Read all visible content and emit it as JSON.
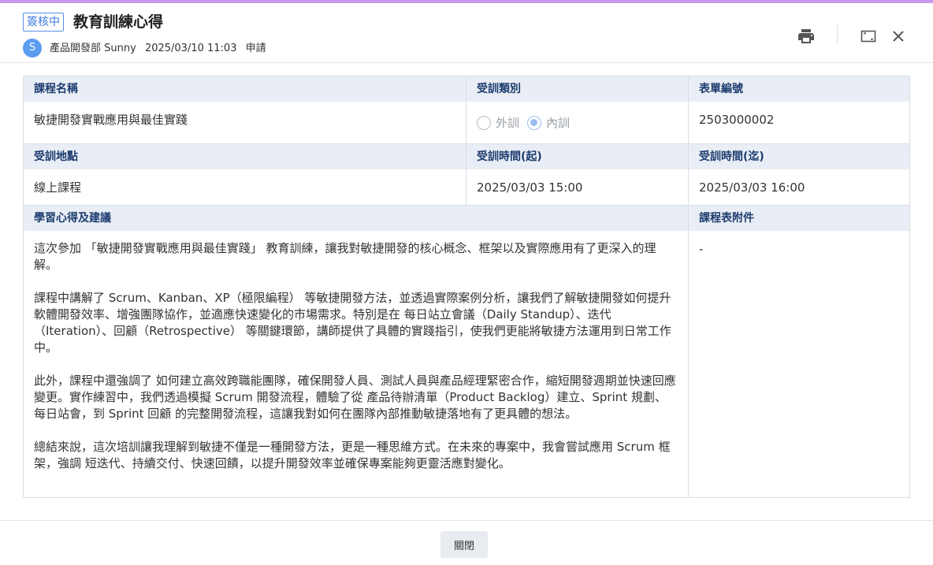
{
  "header": {
    "status": "簽核中",
    "title": "教育訓練心得",
    "avatar_letter": "S",
    "department": "產品開發部 Sunny",
    "datetime": "2025/03/10 11:03",
    "action": "申請"
  },
  "icons": {
    "print": "print-icon",
    "maximize": "maximize-icon",
    "close": "close-icon"
  },
  "colors": {
    "accent_bar": "#c59bf0",
    "label_bg": "#e9eef6",
    "label_text": "#1d3c6e",
    "badge": "#3f7ae0"
  },
  "form": {
    "course_name_label": "課程名稱",
    "course_name": "敏捷開發實戰應用與最佳實踐",
    "training_type_label": "受訓類別",
    "training_type_options": [
      "外訓",
      "內訓"
    ],
    "training_type_selected": "內訓",
    "form_no_label": "表單編號",
    "form_no": "2503000002",
    "location_label": "受訓地點",
    "location": "線上課程",
    "start_label": "受訓時間(起)",
    "start": "2025/03/03 15:00",
    "end_label": "受訓時間(迄)",
    "end": "2025/03/03 16:00",
    "reflection_label": "學習心得及建議",
    "reflection_paragraphs": [
      "這次參加 「敏捷開發實戰應用與最佳實踐」 教育訓練，讓我對敏捷開發的核心概念、框架以及實際應用有了更深入的理解。",
      "課程中講解了 Scrum、Kanban、XP（極限編程） 等敏捷開發方法，並透過實際案例分析，讓我們了解敏捷開發如何提升軟體開發效率、增強團隊協作，並適應快速變化的市場需求。特別是在 每日站立會議（Daily Standup）、迭代（Iteration）、回顧（Retrospective） 等關鍵環節，講師提供了具體的實踐指引，使我們更能將敏捷方法運用到日常工作中。",
      "此外，課程中還強調了 如何建立高效跨職能團隊，確保開發人員、測試人員與產品經理緊密合作，縮短開發週期並快速回應變更。實作練習中，我們透過模擬 Scrum 開發流程，體驗了從 產品待辦清單（Product Backlog）建立、Sprint 規劃、每日站會，到 Sprint 回顧 的完整開發流程，這讓我對如何在團隊內部推動敏捷落地有了更具體的想法。",
      "總結來說，這次培訓讓我理解到敏捷不僅是一種開發方法，更是一種思維方式。在未來的專案中，我會嘗試應用 Scrum 框架，強調 短迭代、持續交付、快速回饋，以提升開發效率並確保專案能夠更靈活應對變化。"
    ],
    "attachment_label": "課程表附件",
    "attachment": "-"
  },
  "footer": {
    "close_label": "關閉"
  }
}
